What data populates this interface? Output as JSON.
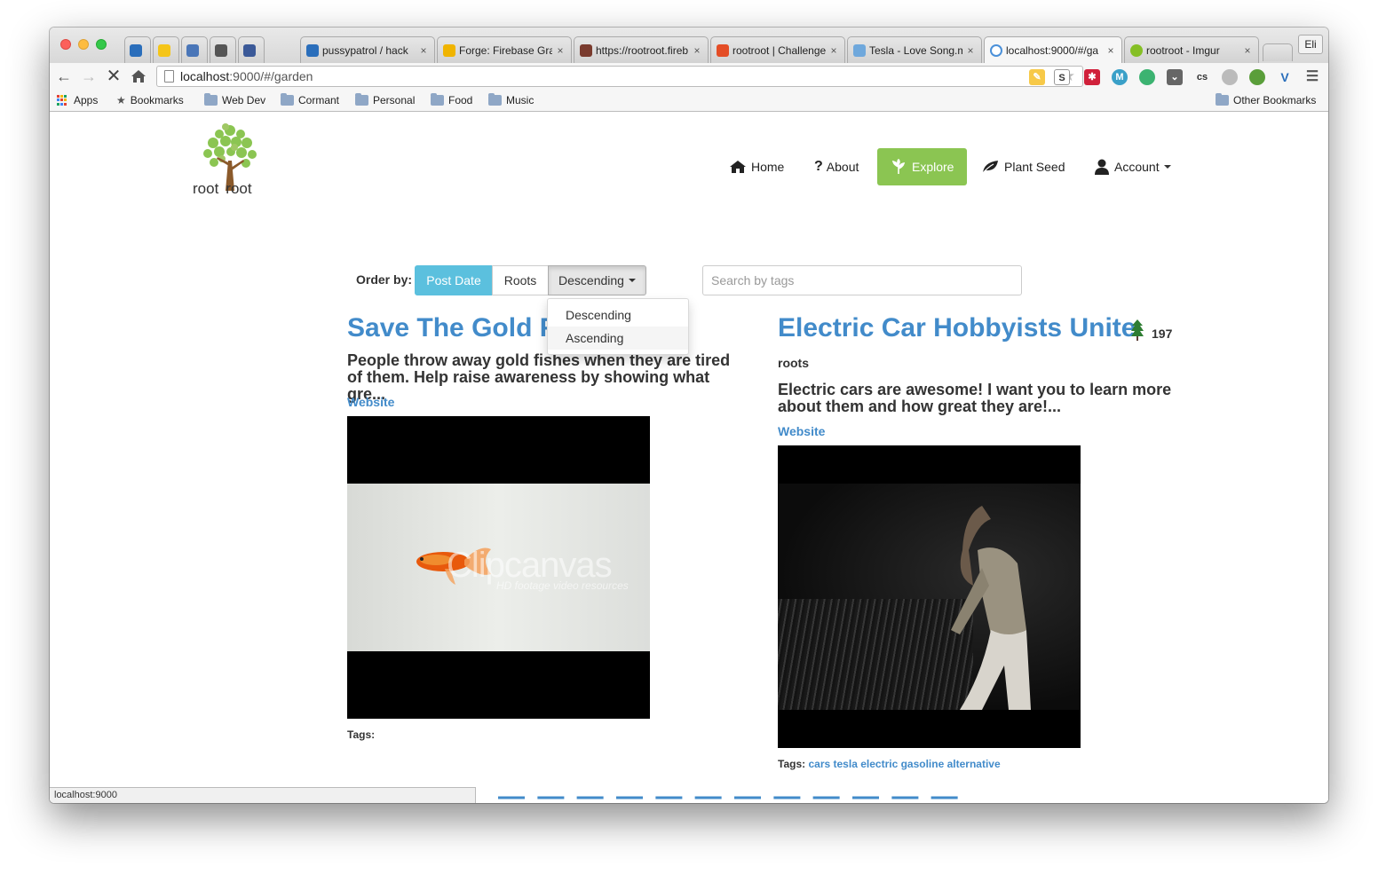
{
  "browser": {
    "tabs": [
      {
        "label": "",
        "favicon_color": "#2a6ebb"
      },
      {
        "label": "",
        "favicon_color": "#f5c518"
      },
      {
        "label": "",
        "favicon_color": "#4a76b8"
      },
      {
        "label": "",
        "favicon_color": "#555555"
      },
      {
        "label": "",
        "favicon_color": "#3b5998"
      },
      {
        "label": "pussypatrol / hack",
        "favicon_color": "#2a6ebb"
      },
      {
        "label": "Forge: Firebase Gra",
        "favicon_color": "#f0b400"
      },
      {
        "label": "https://rootroot.fireb",
        "favicon_color": "#7a3b2e"
      },
      {
        "label": "rootroot | Challenge",
        "favicon_color": "#e44d26"
      },
      {
        "label": "Tesla - Love Song.m",
        "favicon_color": "#6fa8dc"
      },
      {
        "label": "localhost:9000/#/ga",
        "favicon_color": "#4a90d9"
      },
      {
        "label": "rootroot - Imgur",
        "favicon_color": "#85bf25"
      }
    ],
    "profile": "Eli",
    "url_host": "localhost",
    "url_rest": ":9000/#/garden",
    "bookmarks": [
      "Apps",
      "Bookmarks",
      "Web Dev",
      "Cormant",
      "Personal",
      "Food",
      "Music"
    ],
    "other_bookmarks": "Other Bookmarks",
    "status": "localhost:9000"
  },
  "site": {
    "logo_text": "root root",
    "logo_left": "root",
    "logo_right": "root",
    "nav": {
      "home": "Home",
      "about": "About",
      "explore": "Explore",
      "plant_seed": "Plant Seed",
      "account": "Account"
    },
    "order_by_label": "Order by:",
    "order_buttons": {
      "post_date": "Post Date",
      "roots": "Roots",
      "order": "Descending"
    },
    "order_options": [
      "Descending",
      "Ascending"
    ],
    "search_placeholder": "Search by tags",
    "posts": [
      {
        "title": "Save The Gold F",
        "description": "People throw away gold fishes when they are tired of them. Help raise awareness by showing what gre...",
        "link": "Website",
        "tags_label": "Tags:",
        "tags": [],
        "watermark": "Clipcanvas",
        "watermark_sub": "HD footage video resources"
      },
      {
        "title": "Electric Car Hobbyists Unite",
        "roots_count": "197",
        "roots_label": "roots",
        "description": "Electric cars are awesome! I want you to learn more about them and how great they are!...",
        "link": "Website",
        "tags_label": "Tags:",
        "tags": [
          "cars",
          "tesla",
          "electric",
          "gasoline",
          "alternative"
        ]
      }
    ]
  }
}
